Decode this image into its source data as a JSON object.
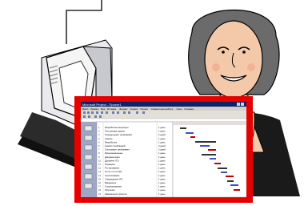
{
  "clipart": {
    "computer_icon": "desktop-computer-icon",
    "woman_icon": "smiling-woman-portrait-icon"
  },
  "window": {
    "frame_color": "#e60000",
    "title": "Microsoft Project - Проект1",
    "menu_items": [
      "Файл",
      "Правка",
      "Вид",
      "Вставка",
      "Формат",
      "Сервис",
      "Проект",
      "Совместная работа",
      "Окно",
      "Справка"
    ],
    "tasks": [
      {
        "name": "Разработка концепции",
        "duration": "1 день"
      },
      {
        "name": "Постановка задачи",
        "duration": "1 день"
      },
      {
        "name": "Определение требований",
        "duration": "2 дней"
      },
      {
        "name": "Анализ",
        "duration": "1 день"
      },
      {
        "name": "Разработка",
        "duration": "1 день"
      },
      {
        "name": "Анализ требований",
        "duration": "3 дней"
      },
      {
        "name": "Системные требования",
        "duration": "2 дней"
      },
      {
        "name": "Функциональные",
        "duration": "1 день"
      },
      {
        "name": "Документация",
        "duration": "1 день"
      },
      {
        "name": "Документ ПО",
        "duration": "1 день"
      },
      {
        "name": "Проверка",
        "duration": "1 день"
      },
      {
        "name": "Тестирование",
        "duration": "1 день"
      },
      {
        "name": "Отчет по тестам",
        "duration": "1 день"
      },
      {
        "name": "Согласование",
        "duration": "1 день"
      },
      {
        "name": "Утверждение ПО",
        "duration": "1 день"
      },
      {
        "name": "Внедрение",
        "duration": "1 день"
      },
      {
        "name": "Сопровождение",
        "duration": "1 день"
      },
      {
        "name": "Обучение",
        "duration": "1 день"
      },
      {
        "name": "Завершение проекта",
        "duration": "1 день"
      }
    ]
  }
}
